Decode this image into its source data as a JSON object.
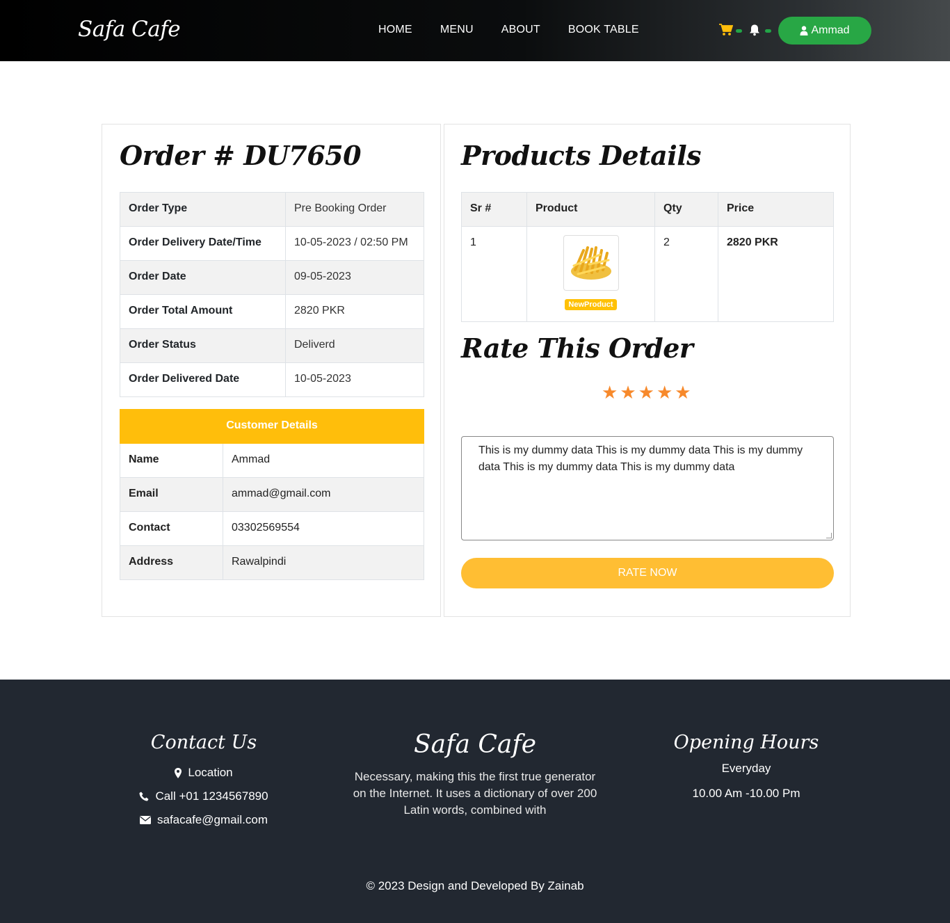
{
  "header": {
    "logo": "Safa Cafe",
    "nav": [
      "HOME",
      "MENU",
      "ABOUT",
      "BOOK TABLE"
    ],
    "cart_icon": "cart-icon",
    "bell_icon": "bell-icon",
    "user_label": "Ammad",
    "colors": {
      "accent": "#ffbe33",
      "user_button": "#28a745"
    }
  },
  "order": {
    "title": "Order # DU7650",
    "rows": [
      {
        "label": "Order Type",
        "value": "Pre Booking Order"
      },
      {
        "label": "Order Delivery Date/Time",
        "value": "10-05-2023 / 02:50 PM"
      },
      {
        "label": "Order Date",
        "value": "09-05-2023"
      },
      {
        "label": "Order Total Amount",
        "value": "2820 PKR"
      },
      {
        "label": "Order Status",
        "value": "Deliverd"
      },
      {
        "label": "Order Delivered Date",
        "value": "10-05-2023"
      }
    ]
  },
  "customer": {
    "heading": "Customer Details",
    "rows": [
      {
        "label": "Name",
        "value": "Ammad"
      },
      {
        "label": "Email",
        "value": "ammad@gmail.com"
      },
      {
        "label": "Contact",
        "value": "03302569554"
      },
      {
        "label": "Address",
        "value": "Rawalpindi"
      }
    ]
  },
  "products": {
    "title": "Products Details",
    "columns": [
      "Sr #",
      "Product",
      "Qty",
      "Price"
    ],
    "items": [
      {
        "sr": "1",
        "badge": "NewProduct",
        "qty": "2",
        "price": "2820 PKR"
      }
    ]
  },
  "rating": {
    "title": "Rate This Order",
    "stars": 5,
    "max_stars": 5,
    "review_text": "This is my dummy data This is my dummy data This is my dummy data This is my dummy data This is my dummy data",
    "button_label": "RATE NOW"
  },
  "footer": {
    "contact_title": "Contact Us",
    "location": "Location",
    "phone": "Call +01 1234567890",
    "email": "safacafe@gmail.com",
    "brand": "Safa Cafe",
    "description": "Necessary, making this the first true generator on the Internet. It uses a dictionary of over 200 Latin words, combined with",
    "hours_title": "Opening Hours",
    "hours_days": "Everyday",
    "hours_time": "10.00 Am -10.00 Pm",
    "copyright": "© 2023 Design and Developed By Zainab"
  }
}
